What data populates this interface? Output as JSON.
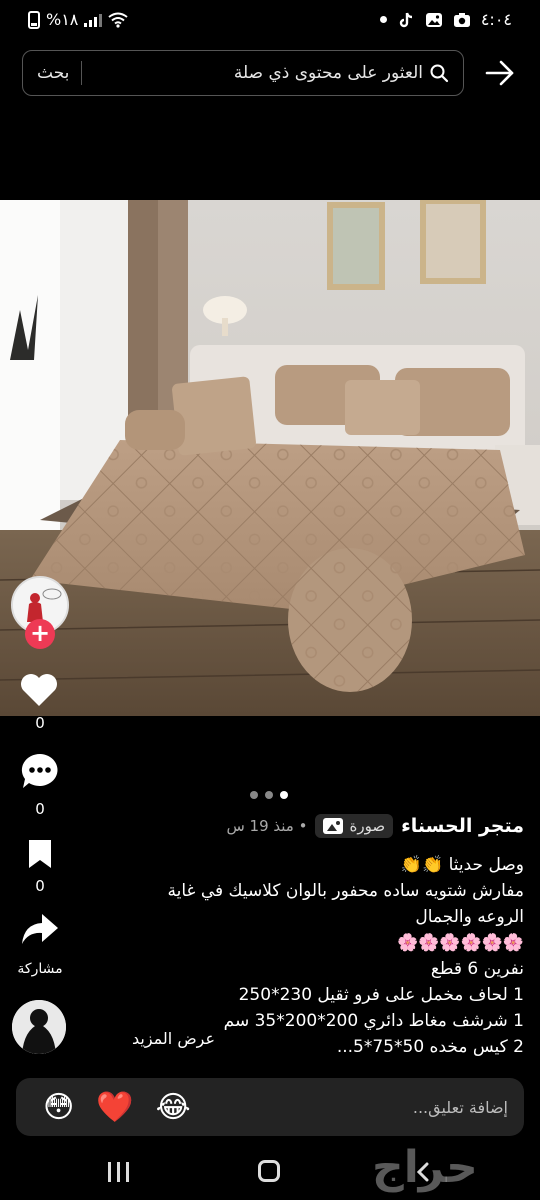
{
  "status_bar": {
    "time": "٤:٠٤",
    "battery": "%١٨",
    "icons": [
      "dot-icon",
      "tiktok-icon",
      "gallery-icon",
      "camera-icon",
      "wifi-icon",
      "signal-icon",
      "battery-icon"
    ]
  },
  "search": {
    "placeholder": "العثور على محتوى ذي صلة",
    "button": "بحث"
  },
  "actions": {
    "likes": "0",
    "comments": "0",
    "bookmarks": "0",
    "share_label": "مشاركة"
  },
  "pager": {
    "count": 3,
    "active": 2
  },
  "post": {
    "store_name": "متجر الحسناء",
    "type_label": "صورة",
    "time_ago": "• منذ 19 س",
    "lines": [
      "وصل حديثا 👏👏",
      "مفارش شتويه ساده  محفور   بالوان كلاسيك  في غاية الروعه والجمال",
      "🌸🌸🌸🌸🌸🌸",
      "نفرين 6 قطع",
      "1 لحاف مخمل على فرو ثقيل 230*250",
      "1 شرشف مغاط دائري 200*200*35 سم",
      "2 كيس مخده 50*75*5..."
    ],
    "see_more": "عرض المزيد"
  },
  "comment": {
    "placeholder": "إضافة تعليق...",
    "emojis": [
      "😂",
      "❤️",
      "😳"
    ]
  },
  "watermark": "حراج",
  "colors": {
    "background": "#000000",
    "accent_red": "#ee3a55",
    "chip_bg": "#2a2a2a",
    "comment_bg": "#232323"
  }
}
